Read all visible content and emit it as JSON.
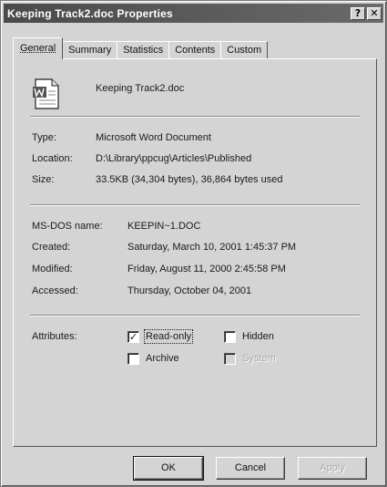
{
  "window": {
    "title": "Keeping Track2.doc Properties",
    "help_button": "?",
    "close_button": "✕"
  },
  "tabs": [
    {
      "label": "General",
      "active": true
    },
    {
      "label": "Summary"
    },
    {
      "label": "Statistics"
    },
    {
      "label": "Contents"
    },
    {
      "label": "Custom"
    }
  ],
  "general": {
    "file_name": "Keeping Track2.doc",
    "file_icon": "word-document-icon",
    "type_label": "Type:",
    "type_value": "Microsoft Word Document",
    "location_label": "Location:",
    "location_value": "D:\\Library\\ppcug\\Articles\\Published",
    "size_label": "Size:",
    "size_value": "33.5KB (34,304 bytes), 36,864 bytes used",
    "msdos_label": "MS-DOS name:",
    "msdos_value": "KEEPIN~1.DOC",
    "created_label": "Created:",
    "created_value": "Saturday, March 10, 2001 1:45:37 PM",
    "modified_label": "Modified:",
    "modified_value": "Friday, August 11, 2000 2:45:58 PM",
    "accessed_label": "Accessed:",
    "accessed_value": "Thursday, October 04, 2001",
    "attributes_label": "Attributes:",
    "attributes": {
      "read_only": {
        "label": "Read-only",
        "checked": true
      },
      "hidden": {
        "label": "Hidden",
        "checked": false
      },
      "archive": {
        "label": "Archive",
        "checked": false
      },
      "system": {
        "label": "System",
        "checked": false,
        "disabled": true
      }
    },
    "check_mark": "✓"
  },
  "buttons": {
    "ok": "OK",
    "cancel": "Cancel",
    "apply": "Apply"
  }
}
